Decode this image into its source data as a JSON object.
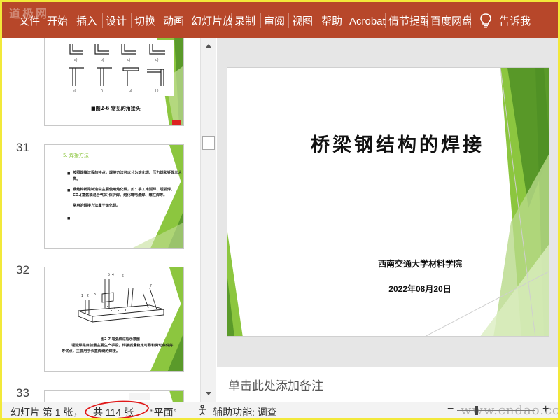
{
  "ribbon": {
    "watermark": "道极网",
    "tabs": [
      "文件",
      "开始",
      "插入",
      "设计",
      "切换",
      "动画",
      "幻灯片放映",
      "录制",
      "审阅",
      "视图",
      "帮助",
      "Acrobat",
      "倩节提醒",
      "百度网盘"
    ],
    "tell_me": "告诉我",
    "tell_me_icon": "lightbulb-icon",
    "bg_color": "#b7472a"
  },
  "thumbnails": {
    "slides": [
      {
        "number": "",
        "caption": "■图2-6  常见的角接头",
        "labels": [
          "a)",
          "b)",
          "c)",
          "d)",
          "e)",
          "f)",
          "g)",
          "h)"
        ]
      },
      {
        "number": "31",
        "heading": "5. 焊接方法",
        "bullets": [
          "按照焊接过程的特点，焊接方法可以分为熔化焊、压力焊和钎焊三大类。",
          "钢结构桥梁制造中主要使用熔化焊，如：手工电弧焊、埋弧焊、CO₂(富氩或混合气体)保护焊、熔化嘴电渣焊、螺柱焊等。",
          "常用的焊接方法属于熔化焊。"
        ]
      },
      {
        "number": "32",
        "caption": "图2-7 埋弧焊过程示意图",
        "text": "埋弧焊是目前最主要生产手段，焊接质量稳定可靠和劳动条件好等优点，主要用于长直焊缝的焊接。",
        "labels": [
          "1",
          "2",
          "3",
          "4",
          "5",
          "6",
          "7"
        ]
      },
      {
        "number": "33"
      }
    ]
  },
  "main_slide": {
    "title": "桥梁钢结构的焊接",
    "school": "西南交通大学材料学院",
    "date": "2022年08月20日"
  },
  "notes": {
    "placeholder": "单击此处添加备注"
  },
  "status": {
    "slide_info_a": "幻灯片 第 1 张，",
    "slide_info_b": "共 114 张",
    "language": "“平面”",
    "accessibility": "辅助功能: 调查",
    "zoom_minus": "−",
    "zoom_plus": "+",
    "watermark": "www.cndao.com"
  },
  "colors": {
    "accent_green": "#8cc63f",
    "dark_green": "#5a9a2a",
    "highlight_red": "#e01818",
    "frame_yellow": "#f2e93a"
  }
}
